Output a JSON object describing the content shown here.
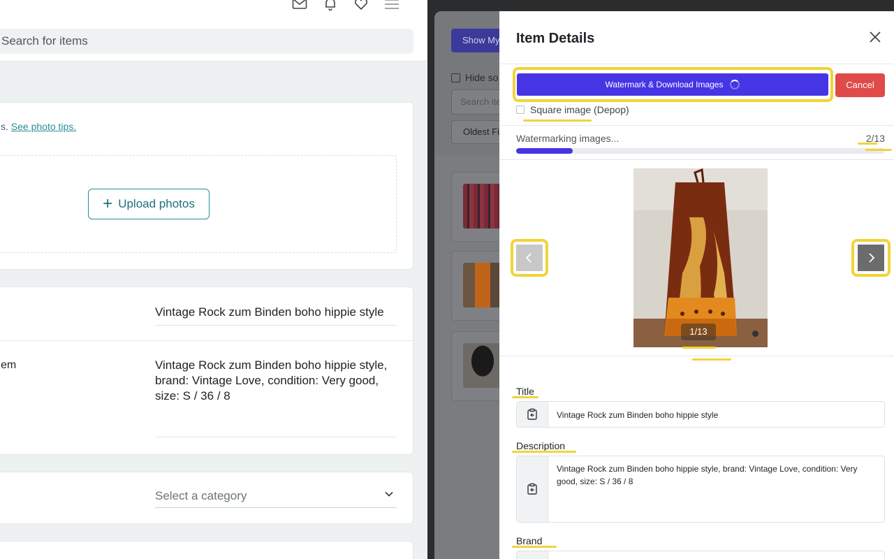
{
  "left": {
    "search_placeholder": "Search for items",
    "photo_tip_prefix": "s.",
    "photo_tip_link": "See photo tips.",
    "upload_label": "Upload photos",
    "title_value": "Vintage Rock zum Binden boho hippie style",
    "desc_label": "em",
    "desc_value": "Vintage Rock zum Binden boho hippie style, brand: Vintage Love, condition: Very good, size: S / 36 / 8",
    "category_placeholder": "Select a category"
  },
  "background": {
    "show_btn": "Show My",
    "hide_label": "Hide so",
    "search_placeholder": "Search ite",
    "sort_label": "Oldest Fi"
  },
  "modal": {
    "title": "Item Details",
    "watermark_btn": "Watermark & Download Images",
    "cancel_btn": "Cancel",
    "square_label": "Square image",
    "square_suffix": " (Depop)",
    "progress_label": "Watermarking images...",
    "progress_count": "2/13",
    "progress_fraction": 0.154,
    "image_counter": "1/13",
    "fields": {
      "title_label": "Title",
      "title_value": "Vintage Rock zum Binden boho hippie style",
      "description_label": "Description",
      "description_value": "Vintage Rock zum Binden boho hippie style, brand: Vintage Love, condition: Very good, size: S / 36 / 8",
      "brand_label": "Brand"
    }
  },
  "colors": {
    "accent": "#4635e4",
    "danger": "#e04a48",
    "highlight": "#f2d33a",
    "teal": "#2a8c96"
  },
  "icons": [
    "mail-icon",
    "bell-icon",
    "heart-icon",
    "menu-icon",
    "plus-icon",
    "chevron-down-icon",
    "close-icon",
    "chevron-left-icon",
    "chevron-right-icon",
    "clipboard-icon"
  ]
}
